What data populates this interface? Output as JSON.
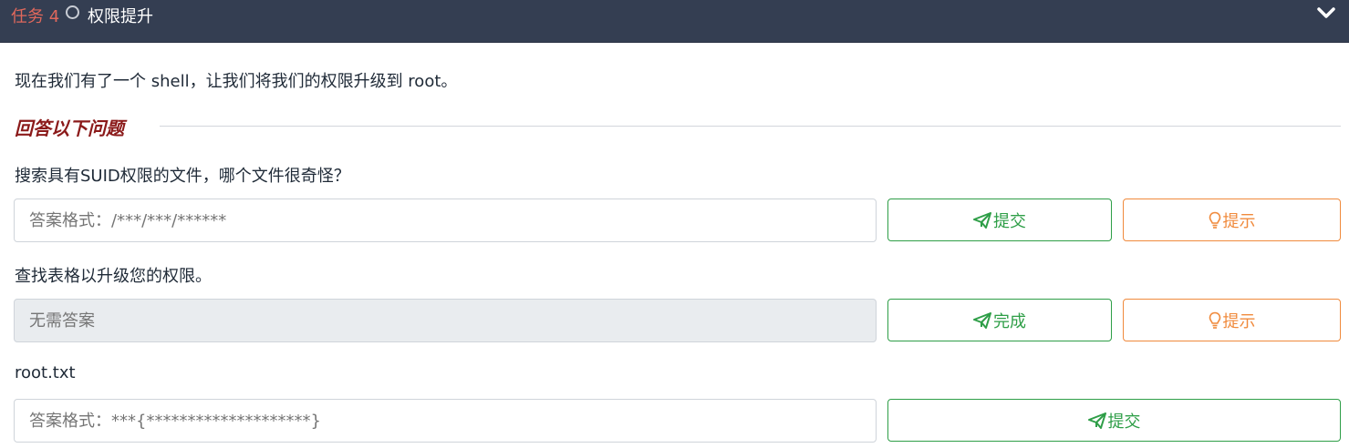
{
  "header": {
    "task_label": "任务 4",
    "task_title": "权限提升",
    "status_icon": "circle-outline-icon",
    "toggle_icon": "chevron-down-icon"
  },
  "intro_text": "现在我们有了一个 shell，让我们将我们的权限升级到 root。",
  "section_heading": "回答以下问题",
  "questions": [
    {
      "text": "搜索具有SUID权限的文件，哪个文件很奇怪？",
      "placeholder": "答案格式：/***/***/******",
      "submit_label": "提交",
      "hint_label": "提示"
    },
    {
      "text": "查找表格以升级您的权限。",
      "placeholder": "无需答案",
      "submit_label": "完成",
      "hint_label": "提示"
    },
    {
      "text": "root.txt",
      "placeholder": "答案格式：***{********************}",
      "submit_label": "提交"
    }
  ],
  "colors": {
    "header_bg": "#343e52",
    "task_label": "#e0685c",
    "heading": "#8b1a1a",
    "submit": "#2e9e47",
    "hint": "#f08a3c"
  }
}
